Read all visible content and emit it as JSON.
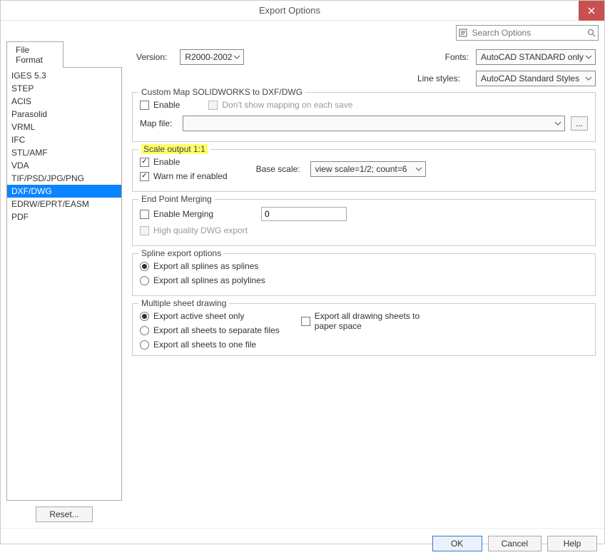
{
  "window": {
    "title": "Export Options"
  },
  "search": {
    "placeholder": "Search Options"
  },
  "tab": {
    "label": "File Format"
  },
  "formats": [
    "IGES 5.3",
    "STEP",
    "ACIS",
    "Parasolid",
    "VRML",
    "IFC",
    "STL/AMF",
    "VDA",
    "TIF/PSD/JPG/PNG",
    "DXF/DWG",
    "EDRW/EPRT/EASM",
    "PDF"
  ],
  "formats_selected": "DXF/DWG",
  "reset": {
    "label": "Reset..."
  },
  "labels": {
    "version": "Version:",
    "fonts": "Fonts:",
    "linestyles": "Line styles:"
  },
  "selects": {
    "version": "R2000-2002",
    "fonts": "AutoCAD STANDARD only",
    "linestyles": "AutoCAD Standard Styles",
    "basescale": "view scale=1/2; count=6"
  },
  "groups": {
    "custommap": {
      "legend": "Custom Map SOLIDWORKS to DXF/DWG",
      "enable": "Enable",
      "dontshow": "Don't show mapping on each save",
      "mapfile_label": "Map file:",
      "browse": "..."
    },
    "scale": {
      "legend": "Scale output 1:1",
      "enable": "Enable",
      "warn": "Warn me if enabled",
      "basescale_label": "Base scale:"
    },
    "endpoint": {
      "legend": "End Point Merging",
      "enable": "Enable Merging",
      "value": "0",
      "hq": "High quality DWG export"
    },
    "spline": {
      "legend": "Spline export options",
      "opt1": "Export all splines as splines",
      "opt2": "Export all splines as polylines"
    },
    "multi": {
      "legend": "Multiple sheet drawing",
      "opt1": "Export active sheet only",
      "opt2": "Export all sheets to separate files",
      "opt3": "Export all sheets to one file",
      "paperspace": "Export all drawing sheets to paper space"
    }
  },
  "footer": {
    "ok": "OK",
    "cancel": "Cancel",
    "help": "Help"
  }
}
